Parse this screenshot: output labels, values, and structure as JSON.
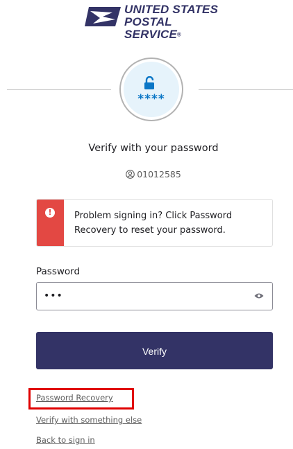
{
  "logo": {
    "line1": "UNITED STATES",
    "line2": "POSTAL SERVICE",
    "registered_mark": "®"
  },
  "auth": {
    "icon": "unlock-icon",
    "masked": "****",
    "title": "Verify with your password",
    "username": "01012585"
  },
  "alert": {
    "text": "Problem signing in? Click Password Recovery to reset your password.",
    "color": "#e34843"
  },
  "form": {
    "password_label": "Password",
    "password_value": "•••",
    "verify_label": "Verify"
  },
  "links": {
    "password_recovery": "Password Recovery",
    "verify_something_else": "Verify with something else",
    "back_to_sign_in": "Back to sign in"
  },
  "colors": {
    "brand": "#333366",
    "accent": "#0a76c6",
    "highlight": "#e00000"
  }
}
